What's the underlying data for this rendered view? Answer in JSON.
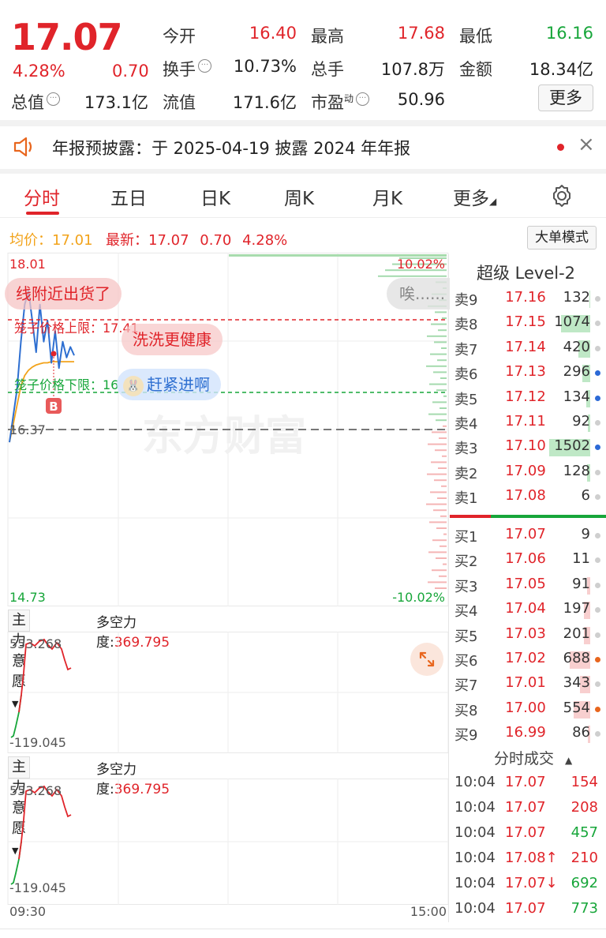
{
  "quote": {
    "price": "17.07",
    "change_pct": "4.28%",
    "change": "0.70",
    "open_label": "今开",
    "open": "16.40",
    "high_label": "最高",
    "high": "17.68",
    "low_label": "最低",
    "low": "16.16",
    "turnover_label": "换手",
    "turnover": "10.73%",
    "volume_label": "总手",
    "volume": "107.8万",
    "amount_label": "金额",
    "amount": "18.34亿",
    "mktcap_label": "总值",
    "mktcap": "173.1亿",
    "float_label": "流值",
    "float": "171.6亿",
    "pe_label": "市盈",
    "pe_sup": "动",
    "pe": "50.96",
    "more_label": "更多"
  },
  "notice": {
    "text": "年报预披露：于 2025-04-19 披露 2024 年年报"
  },
  "tabs": [
    "分时",
    "五日",
    "日K",
    "周K",
    "月K",
    "更多"
  ],
  "avg_bar": {
    "avg_label": "均价：",
    "avg": "17.01",
    "latest_label": "最新：",
    "latest": "17.07",
    "change": "0.70",
    "change_pct": "4.28%",
    "big_order_label": "大单模式"
  },
  "chart": {
    "y_max": "18.01",
    "y_min": "14.73",
    "pct_max": "10.02%",
    "pct_min": "-10.02%",
    "prev_close": "16.37",
    "upper_limit_label": "笼子价格上限：17.41",
    "lower_limit_label": "笼子价格下限：16",
    "buy_marker": "B",
    "watermark": "东方财富",
    "danmaku": [
      "线附近出货了",
      "洗洗更健康",
      "赶紧进啊",
      "唉......"
    ]
  },
  "chart_data": {
    "type": "line",
    "x_range": [
      "09:30",
      "15:00"
    ],
    "ylim": [
      14.73,
      18.01
    ],
    "prev_close": 16.37,
    "series": [
      {
        "values": [
          16.25,
          16.5,
          16.75,
          17.2,
          17.55,
          17.68,
          17.4,
          17.1,
          17.55,
          17.2,
          17.4,
          17.0,
          17.3,
          16.95,
          17.2,
          17.05,
          17.15,
          17.07
        ]
      },
      {
        "values": [
          16.25,
          16.42,
          16.6,
          16.78,
          16.88,
          16.93,
          16.96,
          16.98,
          16.99,
          17.0,
          17.0,
          17.01,
          17.01,
          17.01,
          17.01,
          17.01,
          17.01,
          17.01
        ]
      }
    ]
  },
  "sub1": {
    "dropdown": "主力意愿",
    "indicator_label": "多空力度:",
    "indicator_value": "369.795",
    "top": "553.268",
    "bottom": "-119.045"
  },
  "sub2": {
    "dropdown": "主力意愿",
    "indicator_label": "多空力度:",
    "indicator_value": "369.795",
    "top": "553.268",
    "bottom": "-119.045",
    "time_start": "09:30",
    "time_end": "15:00"
  },
  "level2": {
    "title": "超级 Level-2"
  },
  "sells": [
    {
      "label": "卖9",
      "price": "17.16",
      "vol": "132",
      "bar": 0.02,
      "dot": "#cfcfcf"
    },
    {
      "label": "卖8",
      "price": "17.15",
      "vol": "1074",
      "bar": 0.72,
      "dot": "#cfcfcf"
    },
    {
      "label": "卖7",
      "price": "17.14",
      "vol": "420",
      "bar": 0.28,
      "dot": "#cfcfcf"
    },
    {
      "label": "卖6",
      "price": "17.13",
      "vol": "296",
      "bar": 0.2,
      "dot": "#2c6ad6"
    },
    {
      "label": "卖5",
      "price": "17.12",
      "vol": "134",
      "bar": 0.09,
      "dot": "#2c6ad6"
    },
    {
      "label": "卖4",
      "price": "17.11",
      "vol": "92",
      "bar": 0.06,
      "dot": "#cfcfcf"
    },
    {
      "label": "卖3",
      "price": "17.10",
      "vol": "1502",
      "bar": 1.0,
      "dot": "#2c6ad6"
    },
    {
      "label": "卖2",
      "price": "17.09",
      "vol": "128",
      "bar": 0.08,
      "dot": "#cfcfcf"
    },
    {
      "label": "卖1",
      "price": "17.08",
      "vol": "6",
      "bar": 0.0,
      "dot": "#cfcfcf"
    }
  ],
  "buys": [
    {
      "label": "买1",
      "price": "17.07",
      "vol": "9",
      "bar": 0.0,
      "dot": "#cfcfcf"
    },
    {
      "label": "买2",
      "price": "17.06",
      "vol": "11",
      "bar": 0.0,
      "dot": "#cfcfcf"
    },
    {
      "label": "买3",
      "price": "17.05",
      "vol": "91",
      "bar": 0.07,
      "dot": "#cfcfcf"
    },
    {
      "label": "买4",
      "price": "17.04",
      "vol": "197",
      "bar": 0.15,
      "dot": "#cfcfcf"
    },
    {
      "label": "买5",
      "price": "17.03",
      "vol": "201",
      "bar": 0.15,
      "dot": "#cfcfcf"
    },
    {
      "label": "买6",
      "price": "17.02",
      "vol": "688",
      "bar": 0.5,
      "dot": "#e8661e"
    },
    {
      "label": "买7",
      "price": "17.01",
      "vol": "343",
      "bar": 0.25,
      "dot": "#cfcfcf"
    },
    {
      "label": "买8",
      "price": "17.00",
      "vol": "554",
      "bar": 0.4,
      "dot": "#e8661e"
    },
    {
      "label": "买9",
      "price": "16.99",
      "vol": "86",
      "bar": 0.06,
      "dot": "#cfcfcf"
    }
  ],
  "trades": {
    "title": "分时成交",
    "rows": [
      {
        "time": "10:04",
        "price": "17.07",
        "vol": "154",
        "dir": "buy"
      },
      {
        "time": "10:04",
        "price": "17.07",
        "vol": "208",
        "dir": "buy"
      },
      {
        "time": "10:04",
        "price": "17.07",
        "vol": "457",
        "dir": "sell"
      },
      {
        "time": "10:04",
        "price": "17.08↑",
        "vol": "210",
        "dir": "buy"
      },
      {
        "time": "10:04",
        "price": "17.07↓",
        "vol": "692",
        "dir": "sell"
      },
      {
        "time": "10:04",
        "price": "17.07",
        "vol": "773",
        "dir": "sell"
      }
    ]
  },
  "colors": {
    "up": "#e0242a",
    "down": "#17a63a",
    "price_line": "#2e6fd1",
    "avg_line": "#f2a31b"
  }
}
